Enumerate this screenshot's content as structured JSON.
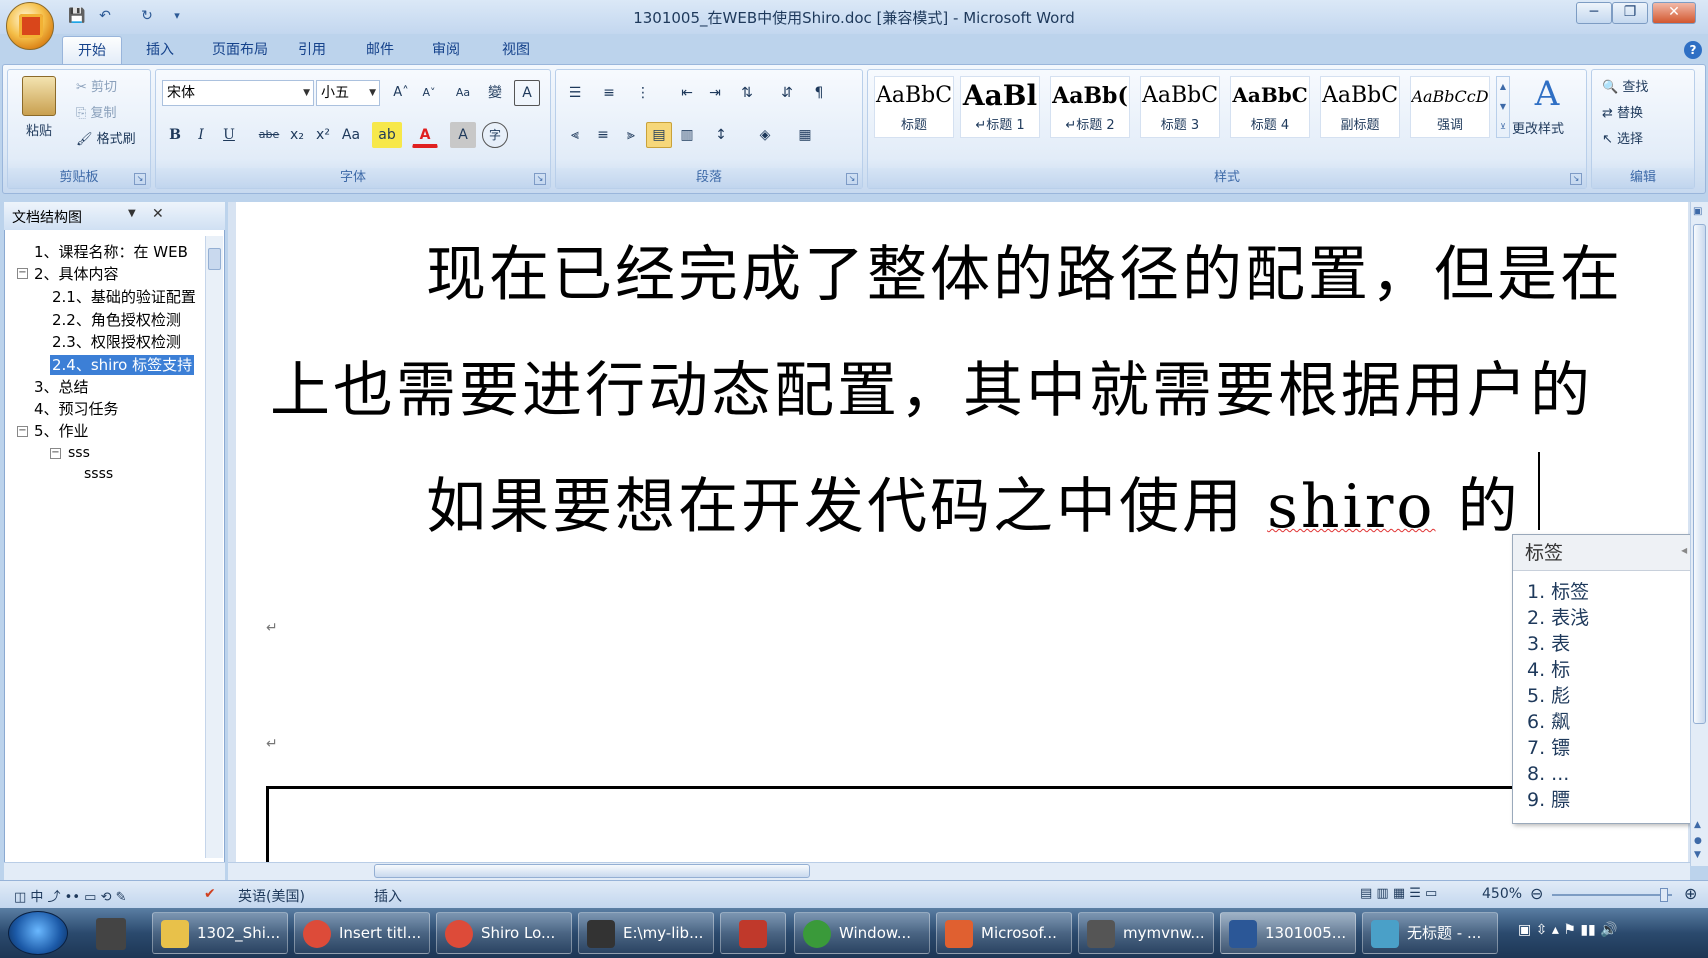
{
  "window": {
    "title": "1301005_在WEB中使用Shiro.doc [兼容模式] - Microsoft Word",
    "min_label": "─",
    "max_label": "❐",
    "close_label": "✕"
  },
  "quick_access": {
    "save": "💾",
    "undo": "↶",
    "redo": "↻",
    "more": "▾"
  },
  "tabs": [
    "开始",
    "插入",
    "页面布局",
    "引用",
    "邮件",
    "审阅",
    "视图"
  ],
  "help_label": "?",
  "ribbon": {
    "clipboard": {
      "paste": "粘贴",
      "cut": "剪切",
      "copy": "复制",
      "format_painter": "格式刷",
      "label": "剪贴板"
    },
    "font": {
      "font_name": "宋体",
      "font_size": "小五",
      "grow": "A˄",
      "shrink": "A˅",
      "clear": "Aa",
      "phonetic": "變",
      "border_char": "A",
      "bold": "B",
      "italic": "I",
      "underline": "U",
      "strike": "abe",
      "sub": "x₂",
      "sup": "x²",
      "case": "Aa",
      "highlight": "ab",
      "font_color": "A",
      "shading": "A",
      "enclose": "字",
      "label": "字体"
    },
    "paragraph": {
      "label": "段落"
    },
    "styles": {
      "items": [
        {
          "sample": "AaBbC",
          "name": "标题"
        },
        {
          "sample": "AaBl",
          "name": "↵标题 1"
        },
        {
          "sample": "AaBb(",
          "name": "↵标题 2"
        },
        {
          "sample": "AaBbC",
          "name": "标题 3"
        },
        {
          "sample": "AaBbC",
          "name": "标题 4"
        },
        {
          "sample": "AaBbC",
          "name": "副标题"
        },
        {
          "sample": "AaBbCcD",
          "name": "强调"
        }
      ],
      "change_styles": "更改样式",
      "label": "样式"
    },
    "editing": {
      "find": "查找",
      "replace": "替换",
      "select": "选择",
      "label": "编辑"
    }
  },
  "nav_pane": {
    "title": "文档结构图",
    "close": "✕",
    "items": [
      {
        "text": "1、课程名称：在 WEB"
      },
      {
        "text": "2、具体内容"
      },
      {
        "text": "2.1、基础的验证配置"
      },
      {
        "text": "2.2、角色授权检测"
      },
      {
        "text": "2.3、权限授权检测"
      },
      {
        "text": "2.4、shiro 标签支持"
      },
      {
        "text": "3、总结"
      },
      {
        "text": "4、预习任务"
      },
      {
        "text": "5、作业"
      },
      {
        "text": "sss"
      },
      {
        "text": "ssss"
      }
    ]
  },
  "document": {
    "line1": "现在已经完成了整体的路径的配置，但是在",
    "line2": "上也需要进行动态配置，其中就需要根据用户的",
    "line3_a": "如果要想在开发代码之中使用 ",
    "line3_b": "shiro",
    "line3_c": " 的",
    "para_mark": "↵"
  },
  "ime": {
    "input": "标签",
    "nav": "◂ ▸",
    "candidates": [
      "1. 标签",
      "2. 表浅",
      "3. 表",
      "4. 标",
      "5. 彪",
      "6. 飙",
      "7. 镖",
      "8. ...",
      "9. 膘"
    ]
  },
  "status": {
    "language": "英语(美国)",
    "mode": "插入",
    "zoom": "450%"
  },
  "taskbar": {
    "items": [
      {
        "label": "1302_Shi...",
        "color": "#e8c14a"
      },
      {
        "label": "Insert titl...",
        "color": "#dd4b39"
      },
      {
        "label": "Shiro Lo...",
        "color": "#dd4b39"
      },
      {
        "label": "E:\\my-lib...",
        "color": "#333333"
      },
      {
        "label": "",
        "color": "#c0392b"
      },
      {
        "label": "Window...",
        "color": "#3a9a3a"
      },
      {
        "label": "Microsof...",
        "color": "#e06030"
      },
      {
        "label": "mymvnw...",
        "color": "#555555"
      },
      {
        "label": "1301005...",
        "color": "#2b5797"
      },
      {
        "label": "无标题 - ...",
        "color": "#4aa0c8"
      }
    ]
  }
}
